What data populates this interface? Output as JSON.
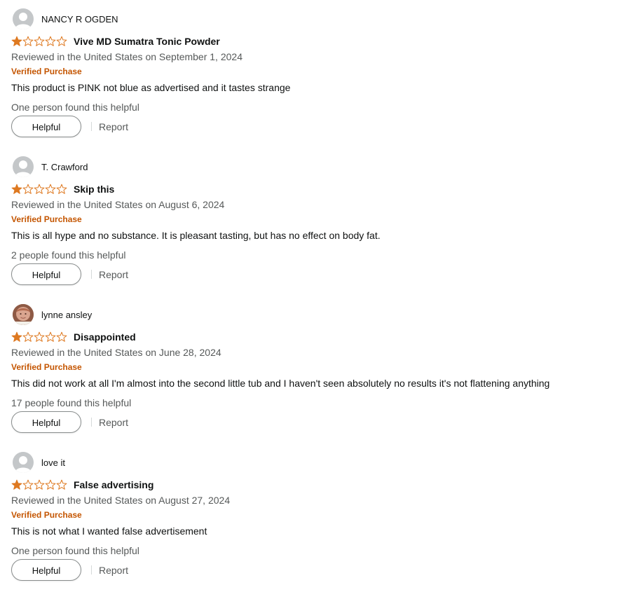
{
  "reviews": [
    {
      "reviewer": "NANCY R OGDEN",
      "avatar": "default-avatar",
      "rating": 1,
      "max_rating": 5,
      "title": "Vive MD Sumatra Tonic Powder",
      "date": "Reviewed in the United States on September 1, 2024",
      "verified": "Verified Purchase",
      "body": "This product is PINK not blue as advertised and it tastes strange",
      "helpful_count": "One person found this helpful",
      "helpful_label": "Helpful",
      "report_label": "Report"
    },
    {
      "reviewer": "T. Crawford",
      "avatar": "default-avatar",
      "rating": 1,
      "max_rating": 5,
      "title": "Skip this",
      "date": "Reviewed in the United States on August 6, 2024",
      "verified": "Verified Purchase",
      "body": "This is all hype and no substance. It is pleasant tasting, but has no effect on body fat.",
      "helpful_count": "2 people found this helpful",
      "helpful_label": "Helpful",
      "report_label": "Report"
    },
    {
      "reviewer": "lynne ansley",
      "avatar": "photo-avatar",
      "rating": 1,
      "max_rating": 5,
      "title": "Disappointed",
      "date": "Reviewed in the United States on June 28, 2024",
      "verified": "Verified Purchase",
      "body": "This did not work at all I'm almost into the second little tub and I haven't seen absolutely no results it's not flattening anything",
      "helpful_count": "17 people found this helpful",
      "helpful_label": "Helpful",
      "report_label": "Report"
    },
    {
      "reviewer": "love it",
      "avatar": "default-avatar",
      "rating": 1,
      "max_rating": 5,
      "title": "False advertising",
      "date": "Reviewed in the United States on August 27, 2024",
      "verified": "Verified Purchase",
      "body": "This is not what I wanted false advertisement",
      "helpful_count": "One person found this helpful",
      "helpful_label": "Helpful",
      "report_label": "Report"
    }
  ],
  "colors": {
    "star_filled": "#de7921",
    "star_empty_stroke": "#de7921",
    "verified": "#c45500",
    "secondary_text": "#565959",
    "avatar_bg": "#c4c7c9"
  }
}
